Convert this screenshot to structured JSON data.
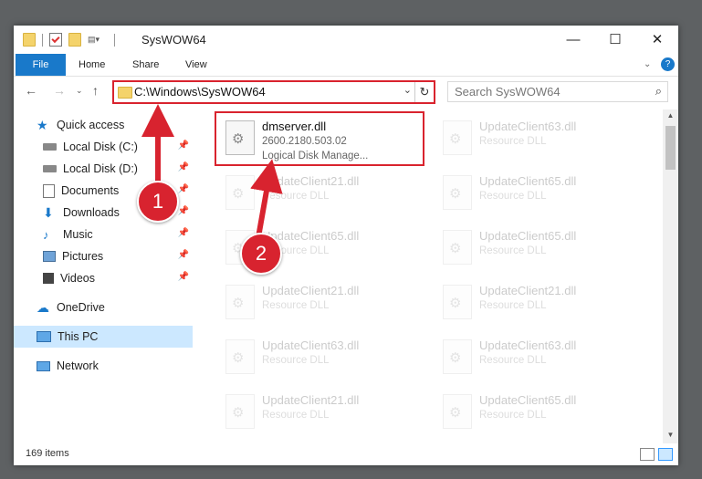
{
  "window": {
    "title": "SysWOW64",
    "minimize_label": "—",
    "maximize_label": "☐",
    "close_label": "✕"
  },
  "ribbon": {
    "tabs": [
      {
        "label": "File"
      },
      {
        "label": "Home"
      },
      {
        "label": "Share"
      },
      {
        "label": "View"
      }
    ],
    "collapse_icon": "chevron-down-icon",
    "help_label": "?"
  },
  "address": {
    "path": "C:\\Windows\\SysWOW64",
    "search_placeholder": "Search SysWOW64"
  },
  "nav": {
    "items": [
      {
        "label": "Quick access",
        "icon": "star-icon"
      },
      {
        "label": "Local Disk (C:)",
        "icon": "drive-icon"
      },
      {
        "label": "Local Disk (D:)",
        "icon": "drive-icon"
      },
      {
        "label": "Documents",
        "icon": "documents-icon"
      },
      {
        "label": "Downloads",
        "icon": "download-icon"
      },
      {
        "label": "Music",
        "icon": "music-icon"
      },
      {
        "label": "Pictures",
        "icon": "pictures-icon"
      },
      {
        "label": "Videos",
        "icon": "videos-icon"
      },
      {
        "label": "OneDrive",
        "icon": "cloud-icon"
      },
      {
        "label": "This PC",
        "icon": "pc-icon"
      },
      {
        "label": "Network",
        "icon": "network-icon"
      }
    ]
  },
  "files": {
    "highlighted": {
      "name": "dmserver.dll",
      "version": "2600.2180.503.02",
      "description": "Logical Disk Manage..."
    },
    "faded": [
      {
        "name": "UpdateClient63.dll",
        "type": "Resource DLL"
      },
      {
        "name": "UpdateClient21.dll",
        "type": "Resource DLL"
      },
      {
        "name": "UpdateClient65.dll",
        "type": "Resource DLL"
      },
      {
        "name": "UpdateClient65.dll",
        "type": "Resource DLL"
      },
      {
        "name": "UpdateClient65.dll",
        "type": "Resource DLL"
      },
      {
        "name": "UpdateClient21.dll",
        "type": "Resource DLL"
      },
      {
        "name": "UpdateClient21.dll",
        "type": "Resource DLL"
      },
      {
        "name": "UpdateClient63.dll",
        "type": "Resource DLL"
      },
      {
        "name": "UpdateClient63.dll",
        "type": "Resource DLL"
      },
      {
        "name": "UpdateClient21.dll",
        "type": "Resource DLL"
      },
      {
        "name": "UpdateClient65.dll",
        "type": "Resource DLL"
      }
    ]
  },
  "status": {
    "item_count": "169 items"
  },
  "annotations": {
    "step1": "1",
    "step2": "2"
  },
  "colors": {
    "accent": "#1979ca",
    "highlight": "#d9232e",
    "selection": "#cce8ff"
  }
}
